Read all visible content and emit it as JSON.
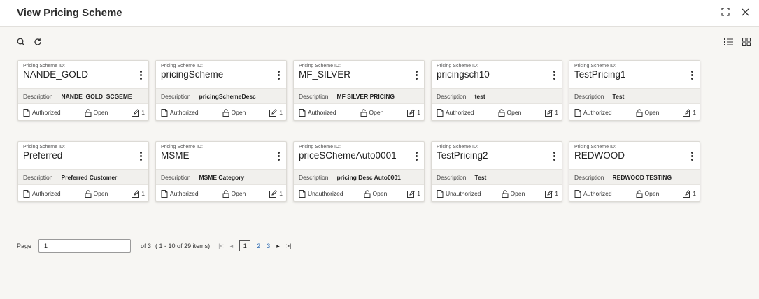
{
  "header": {
    "title": "View Pricing Scheme"
  },
  "cards": [
    {
      "id_label": "Pricing Scheme ID:",
      "id": "NANDE_GOLD",
      "desc_label": "Description",
      "desc": "NANDE_GOLD_SCGEME",
      "auth": "Authorized",
      "lock": "Open",
      "count": "1"
    },
    {
      "id_label": "Pricing Scheme ID:",
      "id": "pricingScheme",
      "desc_label": "Description",
      "desc": "pricingSchemeDesc",
      "auth": "Authorized",
      "lock": "Open",
      "count": "1"
    },
    {
      "id_label": "Pricing Scheme ID:",
      "id": "MF_SILVER",
      "desc_label": "Description",
      "desc": "MF SILVER PRICING",
      "auth": "Authorized",
      "lock": "Open",
      "count": "1"
    },
    {
      "id_label": "Pricing Scheme ID:",
      "id": "pricingsch10",
      "desc_label": "Description",
      "desc": "test",
      "auth": "Authorized",
      "lock": "Open",
      "count": "1"
    },
    {
      "id_label": "Pricing Scheme ID:",
      "id": "TestPricing1",
      "desc_label": "Description",
      "desc": "Test",
      "auth": "Authorized",
      "lock": "Open",
      "count": "1"
    },
    {
      "id_label": "Pricing Scheme ID:",
      "id": "Preferred",
      "desc_label": "Description",
      "desc": "Preferred Customer",
      "auth": "Authorized",
      "lock": "Open",
      "count": "1"
    },
    {
      "id_label": "Pricing Scheme ID:",
      "id": "MSME",
      "desc_label": "Description",
      "desc": "MSME Category",
      "auth": "Authorized",
      "lock": "Open",
      "count": "1"
    },
    {
      "id_label": "Pricing Scheme ID:",
      "id": "priceSChemeAuto0001",
      "desc_label": "Description",
      "desc": "pricing Desc Auto0001",
      "auth": "Unauthorized",
      "lock": "Open",
      "count": "1"
    },
    {
      "id_label": "Pricing Scheme ID:",
      "id": "TestPricing2",
      "desc_label": "Description",
      "desc": "Test",
      "auth": "Unauthorized",
      "lock": "Open",
      "count": "1"
    },
    {
      "id_label": "Pricing Scheme ID:",
      "id": "REDWOOD",
      "desc_label": "Description",
      "desc": "REDWOOD TESTING",
      "auth": "Authorized",
      "lock": "Open",
      "count": "1"
    }
  ],
  "pagination": {
    "page_label": "Page",
    "page_value": "1",
    "of_text": "of 3",
    "range_text": "( 1 - 10 of 29 items)",
    "pages": [
      "1",
      "2",
      "3"
    ],
    "current_page": "1"
  },
  "icons": {
    "search": "search-icon",
    "refresh": "refresh-icon",
    "list_view": "list-view-icon",
    "grid_view": "grid-view-icon",
    "maximize": "maximize-icon",
    "close": "close-icon",
    "document": "document-icon",
    "lock": "unlock-icon",
    "edit": "edit-icon",
    "kebab": "kebab-menu-icon"
  },
  "colors": {
    "background": "#f7f6f3",
    "card": "#ffffff",
    "link": "#2d6bb3"
  }
}
